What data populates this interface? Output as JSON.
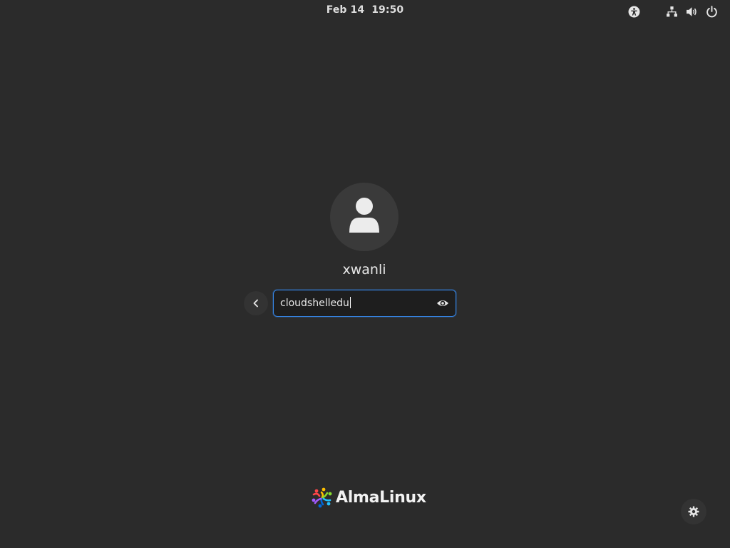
{
  "top_bar": {
    "date": "Feb 14",
    "time": "19:50",
    "status_icons": [
      "accessibility-icon",
      "network-icon",
      "volume-icon",
      "power-icon"
    ]
  },
  "login": {
    "username": "xwanli",
    "password_value": "cloudshelledu",
    "avatar_icon": "user-icon",
    "back_icon": "chevron-left-icon",
    "reveal_icon": "eye-icon"
  },
  "branding": {
    "logo_text": "AlmaLinux"
  },
  "settings": {
    "icon": "gear-icon"
  },
  "colors": {
    "background": "#2b2b2b",
    "focus_ring": "#3584e4",
    "field_bg": "#1e1e1e"
  }
}
